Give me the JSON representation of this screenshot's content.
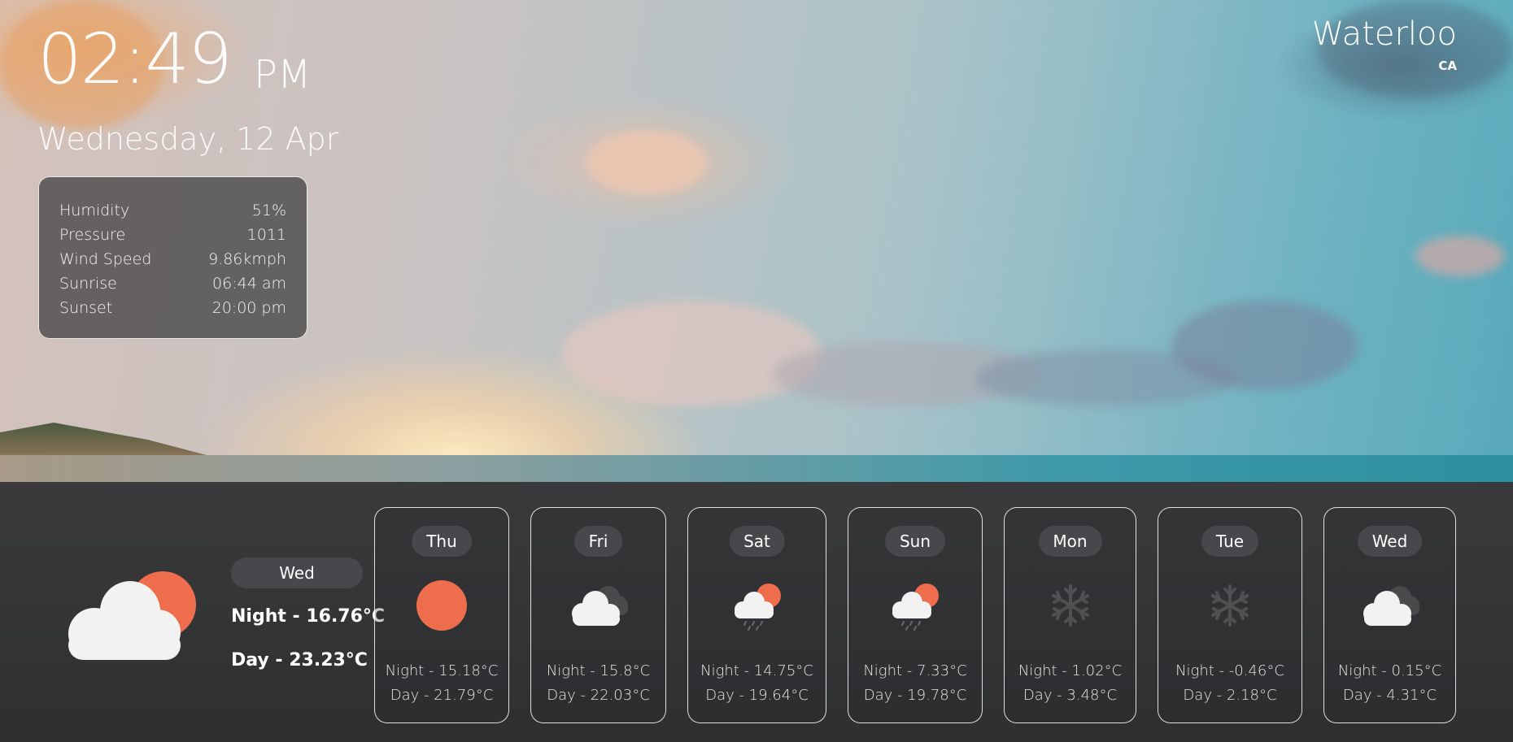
{
  "clock": {
    "time": "02:49",
    "ampm": "PM"
  },
  "date": "Wednesday, 12 Apr",
  "location": {
    "city": "Waterloo",
    "country": "CA"
  },
  "details": [
    {
      "label": "Humidity",
      "value": "51%"
    },
    {
      "label": "Pressure",
      "value": "1011"
    },
    {
      "label": "Wind Speed",
      "value": "9.86kmph"
    },
    {
      "label": "Sunrise",
      "value": "06:44 am"
    },
    {
      "label": "Sunset",
      "value": "20:00 pm"
    }
  ],
  "current": {
    "day": "Wed",
    "night": "Night - 16.76°C",
    "day_temp": "Day - 23.23°C",
    "icon": "partly-cloudy-day-icon"
  },
  "forecast": [
    {
      "day": "Thu",
      "night": "Night - 15.18°C",
      "day_temp": "Day - 21.79°C",
      "icon": "sun-icon"
    },
    {
      "day": "Fri",
      "night": "Night - 15.8°C",
      "day_temp": "Day - 22.03°C",
      "icon": "overcast-clouds-icon"
    },
    {
      "day": "Sat",
      "night": "Night - 14.75°C",
      "day_temp": "Day - 19.64°C",
      "icon": "rain-partly-sunny-icon"
    },
    {
      "day": "Sun",
      "night": "Night - 7.33°C",
      "day_temp": "Day - 19.78°C",
      "icon": "rain-partly-sunny-icon"
    },
    {
      "day": "Mon",
      "night": "Night - 1.02°C",
      "day_temp": "Day - 3.48°C",
      "icon": "snowflake-icon"
    },
    {
      "day": "Tue",
      "night": "Night - -0.46°C",
      "day_temp": "Day - 2.18°C",
      "icon": "snowflake-icon"
    },
    {
      "day": "Wed",
      "night": "Night - 0.15°C",
      "day_temp": "Day - 4.31°C",
      "icon": "overcast-clouds-icon"
    }
  ],
  "colors": {
    "sun": "#ee6d4d",
    "cloud": "#f2f2f2",
    "dark_cloud": "#4a4a4c",
    "snow": "#4d4d50",
    "pill": "#48484c"
  }
}
